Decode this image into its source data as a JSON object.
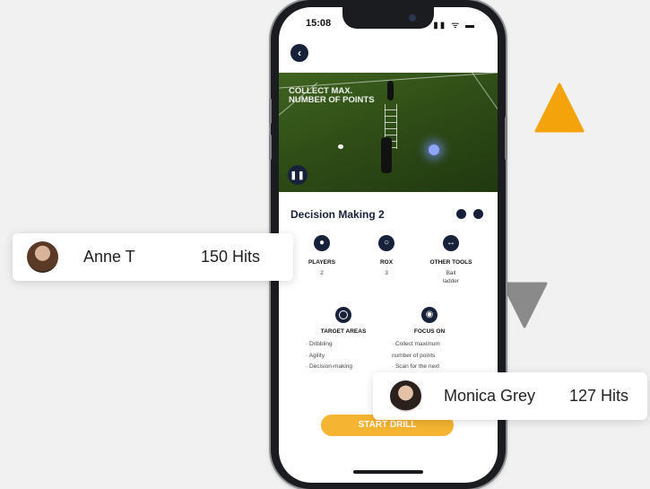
{
  "status_bar": {
    "time": "15:08",
    "icons": "▮▮ ᯤ ▬"
  },
  "video": {
    "caption_line1": "COLLECT MAX.",
    "caption_line2": "NUMBER OF POINTS",
    "pause_icon": "pause-icon"
  },
  "drill": {
    "title": "Decision Making 2",
    "stats": [
      {
        "label": "PLAYERS",
        "value": "2",
        "icon": "person-icon"
      },
      {
        "label": "ROX",
        "value": "3",
        "icon": "rox-icon"
      },
      {
        "label": "OTHER TOOLS",
        "value_line1": "Ball",
        "value_line2": "ladder",
        "icon": "tools-icon"
      }
    ],
    "target_areas": {
      "label": "TARGET AREAS",
      "items": [
        "· Dribbling",
        "· Agility",
        "· Decision-making"
      ]
    },
    "focus_on": {
      "label": "FOCUS ON",
      "items": [
        "· Collect maximum",
        "number of points",
        "· Scan for the next"
      ]
    },
    "start_button": "START DRILL"
  },
  "cards": [
    {
      "name": "Anne T",
      "hits": "150 Hits"
    },
    {
      "name": "Monica Grey",
      "hits": "127 Hits"
    }
  ],
  "colors": {
    "accent": "#f5b431",
    "navy": "#17223a",
    "arrow_gray": "#8a8a8a",
    "triangle_orange": "#f5a30a"
  }
}
